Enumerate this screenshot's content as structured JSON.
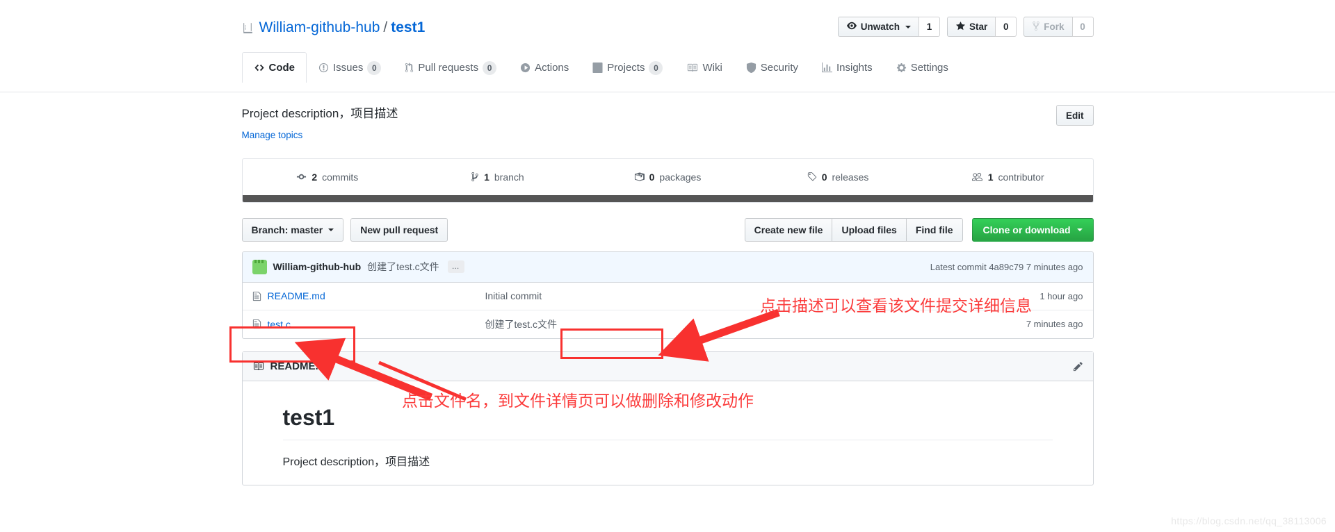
{
  "header": {
    "repo_icon": "repo-book-icon",
    "owner": "William-github-hub",
    "separator": "/",
    "repo_name": "test1",
    "actions": {
      "watch": {
        "icon": "eye-icon",
        "label": "Unwatch",
        "count": "1"
      },
      "star": {
        "icon": "star-icon",
        "label": "Star",
        "count": "0"
      },
      "fork": {
        "icon": "fork-icon",
        "label": "Fork",
        "count": "0"
      }
    }
  },
  "tabs": [
    {
      "icon": "code-icon",
      "label": "Code",
      "count": "",
      "selected": true
    },
    {
      "icon": "issue-opened-icon",
      "label": "Issues",
      "count": "0",
      "selected": false
    },
    {
      "icon": "git-pull-request-icon",
      "label": "Pull requests",
      "count": "0",
      "selected": false
    },
    {
      "icon": "play-icon",
      "label": "Actions",
      "count": "",
      "selected": false
    },
    {
      "icon": "project-icon",
      "label": "Projects",
      "count": "0",
      "selected": false
    },
    {
      "icon": "book-icon",
      "label": "Wiki",
      "count": "",
      "selected": false
    },
    {
      "icon": "shield-icon",
      "label": "Security",
      "count": "",
      "selected": false
    },
    {
      "icon": "graph-icon",
      "label": "Insights",
      "count": "",
      "selected": false
    },
    {
      "icon": "gear-icon",
      "label": "Settings",
      "count": "",
      "selected": false
    }
  ],
  "description": {
    "text": "Project description，项目描述",
    "manage_topics": "Manage topics",
    "edit_label": "Edit"
  },
  "stats": [
    {
      "icon": "commit-icon",
      "number": "2",
      "label": "commits"
    },
    {
      "icon": "branch-icon",
      "number": "1",
      "label": "branch"
    },
    {
      "icon": "package-icon",
      "number": "0",
      "label": "packages"
    },
    {
      "icon": "tag-icon",
      "number": "0",
      "label": "releases"
    },
    {
      "icon": "people-icon",
      "number": "1",
      "label": "contributor"
    }
  ],
  "file_actions": {
    "branch_selector": "Branch: master",
    "new_pull_request": "New pull request",
    "create_new_file": "Create new file",
    "upload_files": "Upload files",
    "find_file": "Find file",
    "clone_or_download": "Clone or download"
  },
  "commit_bar": {
    "author": "William-github-hub",
    "message": "创建了test.c文件",
    "ellipsis": "…",
    "latest_commit_label": "Latest commit",
    "sha": "4a89c79",
    "time": "7 minutes ago"
  },
  "files": [
    {
      "icon": "file-icon",
      "name": "README.md",
      "message": "Initial commit",
      "time": "1 hour ago"
    },
    {
      "icon": "file-icon",
      "name": "test.c",
      "message": "创建了test.c文件",
      "time": "7 minutes ago"
    }
  ],
  "readme": {
    "icon": "book-icon",
    "title": "README.md",
    "edit_icon": "pencil-icon",
    "heading": "test1",
    "paragraph": "Project description，项目描述"
  },
  "annotations": [
    {
      "id": "anno-commit-message",
      "text": "点击描述可以查看该文件提交详细信息"
    },
    {
      "id": "anno-file-name",
      "text": "点击文件名，到文件详情页可以做删除和修改动作"
    }
  ],
  "watermark": "https://blog.csdn.net/qq_38113006",
  "colors": {
    "link": "#0366d6",
    "green_button": "#28a745",
    "annotation_red": "#fb3b3b",
    "commit_bar_bg": "#f1f8ff",
    "language_bar": "#555555"
  }
}
